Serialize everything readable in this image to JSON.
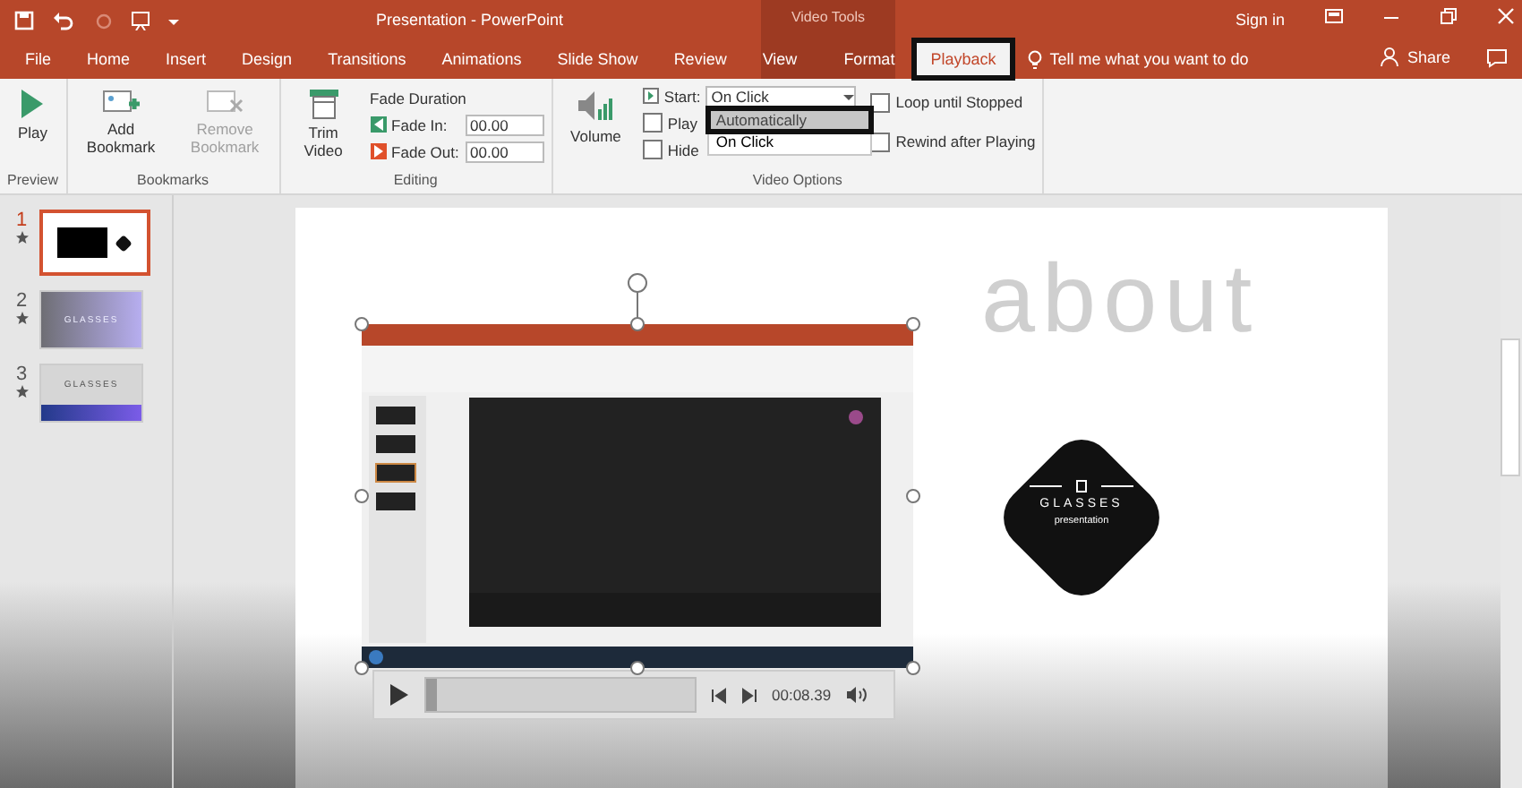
{
  "window": {
    "title": "Presentation - PowerPoint",
    "context_tab_group": "Video Tools",
    "sign_in": "Sign in"
  },
  "tabs": [
    {
      "label": "File",
      "selected": false,
      "highlighted": false
    },
    {
      "label": "Home",
      "selected": false,
      "highlighted": false
    },
    {
      "label": "Insert",
      "selected": false,
      "highlighted": false
    },
    {
      "label": "Design",
      "selected": false,
      "highlighted": false
    },
    {
      "label": "Transitions",
      "selected": false,
      "highlighted": false
    },
    {
      "label": "Animations",
      "selected": false,
      "highlighted": false
    },
    {
      "label": "Slide Show",
      "selected": false,
      "highlighted": false
    },
    {
      "label": "Review",
      "selected": false,
      "highlighted": false
    },
    {
      "label": "View",
      "selected": false,
      "highlighted": false
    },
    {
      "label": "Format",
      "selected": false,
      "highlighted": false
    },
    {
      "label": "Playback",
      "selected": true,
      "highlighted": true
    }
  ],
  "tell_me": {
    "placeholder": "Tell me what you want to do"
  },
  "share": "Share",
  "ribbon": {
    "preview": {
      "label": "Preview",
      "play": "Play"
    },
    "bookmarks": {
      "label": "Bookmarks",
      "add": {
        "label": "Add Bookmark",
        "disabled": false
      },
      "remove": {
        "label": "Remove Bookmark",
        "disabled": true
      }
    },
    "editing": {
      "label": "Editing",
      "trim": "Trim Video",
      "fade_duration": "Fade Duration",
      "fade_in": {
        "label": "Fade In:",
        "value": "00.00"
      },
      "fade_out": {
        "label": "Fade Out:",
        "value": "00.00"
      }
    },
    "video_options": {
      "label": "Video Options",
      "volume": "Volume",
      "start": {
        "label": "Start:",
        "value": "On Click",
        "expanded": true,
        "options": [
          {
            "label": "Automatically",
            "selected": false,
            "highlighted": true
          },
          {
            "label": "On Click",
            "selected": true,
            "highlighted": false
          }
        ]
      },
      "checks": [
        {
          "label": "Play",
          "checked": false
        },
        {
          "label": "Hide",
          "checked": false
        }
      ],
      "checks_right": [
        {
          "label": "Loop until Stopped",
          "checked": false
        },
        {
          "label": "Rewind after Playing",
          "checked": false
        }
      ]
    }
  },
  "slides": [
    {
      "number": "1",
      "selected": true,
      "kind": "video"
    },
    {
      "number": "2",
      "selected": false,
      "kind": "title",
      "text": "GLASSES"
    },
    {
      "number": "3",
      "selected": false,
      "kind": "banner",
      "text": "GLASSES"
    }
  ],
  "slide": {
    "heading": "about",
    "badge": {
      "title": "GLASSES",
      "subtitle": "presentation"
    },
    "video": {
      "kind": "picture",
      "player": {
        "level": 0.02,
        "time": "00:08.39"
      }
    }
  }
}
